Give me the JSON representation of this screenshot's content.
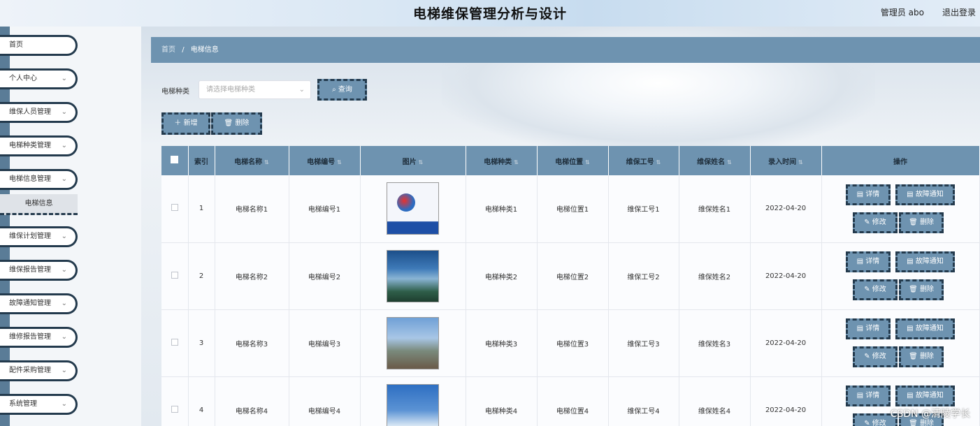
{
  "header": {
    "title": "电梯维保管理分析与设计",
    "user": "管理员 abo",
    "logout": "退出登录"
  },
  "sidebar": {
    "items": [
      {
        "label": "首页",
        "has_children": false
      },
      {
        "label": "个人中心",
        "has_children": true
      },
      {
        "label": "维保人员管理",
        "has_children": true
      },
      {
        "label": "电梯种类管理",
        "has_children": true
      },
      {
        "label": "电梯信息管理",
        "has_children": true
      },
      {
        "label": "维保计划管理",
        "has_children": true
      },
      {
        "label": "维保报告管理",
        "has_children": true
      },
      {
        "label": "故障通知管理",
        "has_children": true
      },
      {
        "label": "维修报告管理",
        "has_children": true
      },
      {
        "label": "配件采购管理",
        "has_children": true
      },
      {
        "label": "系统管理",
        "has_children": true
      }
    ],
    "active_sub": "电梯信息"
  },
  "breadcrumb": {
    "home": "首页",
    "separator": "/",
    "current": "电梯信息"
  },
  "search": {
    "label": "电梯种类",
    "placeholder": "请选择电梯种类",
    "button": "查询"
  },
  "actions": {
    "add": "新增",
    "delete": "删除"
  },
  "table": {
    "headers": [
      "索引",
      "电梯名称",
      "电梯编号",
      "图片",
      "电梯种类",
      "电梯位置",
      "维保工号",
      "维保姓名",
      "录入时间",
      "操作"
    ],
    "rows": [
      {
        "index": "1",
        "name": "电梯名称1",
        "code": "电梯编号1",
        "type": "电梯种类1",
        "location": "电梯位置1",
        "worker_id": "维保工号1",
        "worker_name": "维保姓名1",
        "date": "2022-04-20"
      },
      {
        "index": "2",
        "name": "电梯名称2",
        "code": "电梯编号2",
        "type": "电梯种类2",
        "location": "电梯位置2",
        "worker_id": "维保工号2",
        "worker_name": "维保姓名2",
        "date": "2022-04-20"
      },
      {
        "index": "3",
        "name": "电梯名称3",
        "code": "电梯编号3",
        "type": "电梯种类3",
        "location": "电梯位置3",
        "worker_id": "维保工号3",
        "worker_name": "维保姓名3",
        "date": "2022-04-20"
      },
      {
        "index": "4",
        "name": "电梯名称4",
        "code": "电梯编号4",
        "type": "电梯种类4",
        "location": "电梯位置4",
        "worker_id": "维保工号4",
        "worker_name": "维保姓名4",
        "date": "2022-04-20"
      }
    ],
    "row_actions": {
      "detail": "详情",
      "fault": "故障通知",
      "edit": "修改",
      "delete": "删除"
    }
  },
  "watermark": "CSDN @清陵学长",
  "colors": {
    "accent": "#6e93b0",
    "dark_border": "#233a4d",
    "sidebar_stripe": "#5a7c97"
  }
}
